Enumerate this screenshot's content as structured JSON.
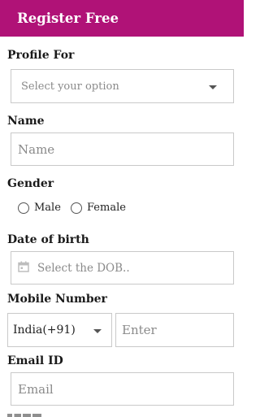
{
  "header": {
    "title": "Register Free"
  },
  "profile": {
    "label": "Profile For",
    "placeholder": "Select your option"
  },
  "name": {
    "label": "Name",
    "placeholder": "Name"
  },
  "gender": {
    "label": "Gender",
    "options": [
      "Male",
      "Female"
    ]
  },
  "dob": {
    "label": "Date of birth",
    "placeholder": "Select the DOB.."
  },
  "mobile": {
    "label": "Mobile Number",
    "country_code": "India(+91)",
    "placeholder": "Enter"
  },
  "email": {
    "label": "Email ID",
    "placeholder": "Email"
  },
  "colors": {
    "brand": "#b01277",
    "border": "#c9c9c9"
  }
}
